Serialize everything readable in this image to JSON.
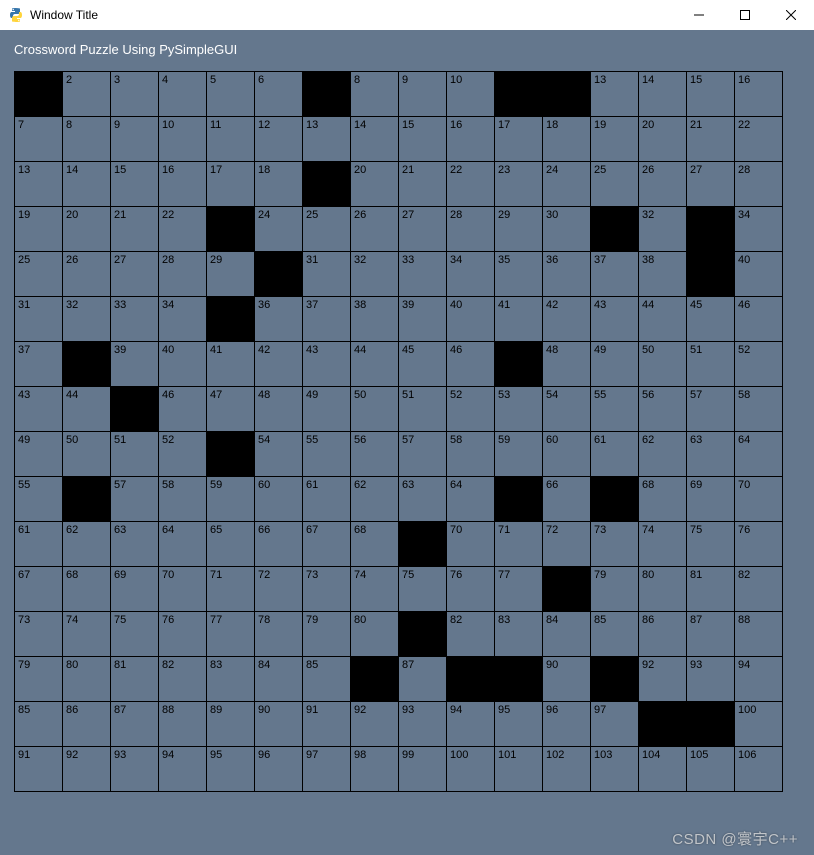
{
  "window": {
    "title": "Window Title"
  },
  "heading": "Crossword Puzzle Using PySimpleGUI",
  "watermark": "CSDN @寰宇C++",
  "grid": {
    "cols": 16,
    "rows": 16,
    "cells": [
      [
        {
          "b": true
        },
        {
          "n": "2"
        },
        {
          "n": "3"
        },
        {
          "n": "4"
        },
        {
          "n": "5"
        },
        {
          "n": "6"
        },
        {
          "b": true
        },
        {
          "n": "8"
        },
        {
          "n": "9"
        },
        {
          "n": "10"
        },
        {
          "b": true
        },
        {
          "b": true
        },
        {
          "n": "13"
        },
        {
          "n": "14"
        },
        {
          "n": "15"
        },
        {
          "n": "16"
        }
      ],
      [
        {
          "n": "7"
        },
        {
          "n": "8"
        },
        {
          "n": "9"
        },
        {
          "n": "10"
        },
        {
          "n": "11"
        },
        {
          "n": "12"
        },
        {
          "n": "13"
        },
        {
          "n": "14"
        },
        {
          "n": "15"
        },
        {
          "n": "16"
        },
        {
          "n": "17"
        },
        {
          "n": "18"
        },
        {
          "n": "19"
        },
        {
          "n": "20"
        },
        {
          "n": "21"
        },
        {
          "n": "22"
        }
      ],
      [
        {
          "n": "13"
        },
        {
          "n": "14"
        },
        {
          "n": "15"
        },
        {
          "n": "16"
        },
        {
          "n": "17"
        },
        {
          "n": "18"
        },
        {
          "b": true
        },
        {
          "n": "20"
        },
        {
          "n": "21"
        },
        {
          "n": "22"
        },
        {
          "n": "23"
        },
        {
          "n": "24"
        },
        {
          "n": "25"
        },
        {
          "n": "26"
        },
        {
          "n": "27"
        },
        {
          "n": "28"
        }
      ],
      [
        {
          "n": "19"
        },
        {
          "n": "20"
        },
        {
          "n": "21"
        },
        {
          "n": "22"
        },
        {
          "b": true
        },
        {
          "n": "24"
        },
        {
          "n": "25"
        },
        {
          "n": "26"
        },
        {
          "n": "27"
        },
        {
          "n": "28"
        },
        {
          "n": "29"
        },
        {
          "n": "30"
        },
        {
          "b": true
        },
        {
          "n": "32"
        },
        {
          "b": true
        },
        {
          "n": "34"
        }
      ],
      [
        {
          "n": "25"
        },
        {
          "n": "26"
        },
        {
          "n": "27"
        },
        {
          "n": "28"
        },
        {
          "n": "29"
        },
        {
          "b": true
        },
        {
          "n": "31"
        },
        {
          "n": "32"
        },
        {
          "n": "33"
        },
        {
          "n": "34"
        },
        {
          "n": "35"
        },
        {
          "n": "36"
        },
        {
          "n": "37"
        },
        {
          "n": "38"
        },
        {
          "b": true
        },
        {
          "n": "40"
        }
      ],
      [
        {
          "n": "31"
        },
        {
          "n": "32"
        },
        {
          "n": "33"
        },
        {
          "n": "34"
        },
        {
          "b": true
        },
        {
          "n": "36"
        },
        {
          "n": "37"
        },
        {
          "n": "38"
        },
        {
          "n": "39"
        },
        {
          "n": "40"
        },
        {
          "n": "41"
        },
        {
          "n": "42"
        },
        {
          "n": "43"
        },
        {
          "n": "44"
        },
        {
          "n": "45"
        },
        {
          "n": "46"
        }
      ],
      [
        {
          "n": "37"
        },
        {
          "b": true
        },
        {
          "n": "39"
        },
        {
          "n": "40"
        },
        {
          "n": "41"
        },
        {
          "n": "42"
        },
        {
          "n": "43"
        },
        {
          "n": "44"
        },
        {
          "n": "45"
        },
        {
          "n": "46"
        },
        {
          "b": true
        },
        {
          "n": "48"
        },
        {
          "n": "49"
        },
        {
          "n": "50"
        },
        {
          "n": "51"
        },
        {
          "n": "52"
        }
      ],
      [
        {
          "n": "43"
        },
        {
          "n": "44"
        },
        {
          "b": true
        },
        {
          "n": "46"
        },
        {
          "n": "47"
        },
        {
          "n": "48"
        },
        {
          "n": "49"
        },
        {
          "n": "50"
        },
        {
          "n": "51"
        },
        {
          "n": "52"
        },
        {
          "n": "53"
        },
        {
          "n": "54"
        },
        {
          "n": "55"
        },
        {
          "n": "56"
        },
        {
          "n": "57"
        },
        {
          "n": "58"
        }
      ],
      [
        {
          "n": "49"
        },
        {
          "n": "50"
        },
        {
          "n": "51"
        },
        {
          "n": "52"
        },
        {
          "b": true
        },
        {
          "n": "54"
        },
        {
          "n": "55"
        },
        {
          "n": "56"
        },
        {
          "n": "57"
        },
        {
          "n": "58"
        },
        {
          "n": "59"
        },
        {
          "n": "60"
        },
        {
          "n": "61"
        },
        {
          "n": "62"
        },
        {
          "n": "63"
        },
        {
          "n": "64"
        }
      ],
      [
        {
          "n": "55"
        },
        {
          "b": true
        },
        {
          "n": "57"
        },
        {
          "n": "58"
        },
        {
          "n": "59"
        },
        {
          "n": "60"
        },
        {
          "n": "61"
        },
        {
          "n": "62"
        },
        {
          "n": "63"
        },
        {
          "n": "64"
        },
        {
          "b": true
        },
        {
          "n": "66"
        },
        {
          "b": true
        },
        {
          "n": "68"
        },
        {
          "n": "69"
        },
        {
          "n": "70"
        }
      ],
      [
        {
          "n": "61"
        },
        {
          "n": "62"
        },
        {
          "n": "63"
        },
        {
          "n": "64"
        },
        {
          "n": "65"
        },
        {
          "n": "66"
        },
        {
          "n": "67"
        },
        {
          "n": "68"
        },
        {
          "b": true
        },
        {
          "n": "70"
        },
        {
          "n": "71"
        },
        {
          "n": "72"
        },
        {
          "n": "73"
        },
        {
          "n": "74"
        },
        {
          "n": "75"
        },
        {
          "n": "76"
        }
      ],
      [
        {
          "n": "67"
        },
        {
          "n": "68"
        },
        {
          "n": "69"
        },
        {
          "n": "70"
        },
        {
          "n": "71"
        },
        {
          "n": "72"
        },
        {
          "n": "73"
        },
        {
          "n": "74"
        },
        {
          "n": "75"
        },
        {
          "n": "76"
        },
        {
          "n": "77"
        },
        {
          "b": true
        },
        {
          "n": "79"
        },
        {
          "n": "80"
        },
        {
          "n": "81"
        },
        {
          "n": "82"
        }
      ],
      [
        {
          "n": "73"
        },
        {
          "n": "74"
        },
        {
          "n": "75"
        },
        {
          "n": "76"
        },
        {
          "n": "77"
        },
        {
          "n": "78"
        },
        {
          "n": "79"
        },
        {
          "n": "80"
        },
        {
          "b": true
        },
        {
          "n": "82"
        },
        {
          "n": "83"
        },
        {
          "n": "84"
        },
        {
          "n": "85"
        },
        {
          "n": "86"
        },
        {
          "n": "87"
        },
        {
          "n": "88"
        }
      ],
      [
        {
          "n": "79"
        },
        {
          "n": "80"
        },
        {
          "n": "81"
        },
        {
          "n": "82"
        },
        {
          "n": "83"
        },
        {
          "n": "84"
        },
        {
          "n": "85"
        },
        {
          "b": true
        },
        {
          "n": "87"
        },
        {
          "b": true
        },
        {
          "b": true
        },
        {
          "n": "90"
        },
        {
          "b": true
        },
        {
          "n": "92"
        },
        {
          "n": "93"
        },
        {
          "n": "94"
        }
      ],
      [
        {
          "n": "85"
        },
        {
          "n": "86"
        },
        {
          "n": "87"
        },
        {
          "n": "88"
        },
        {
          "n": "89"
        },
        {
          "n": "90"
        },
        {
          "n": "91"
        },
        {
          "n": "92"
        },
        {
          "n": "93"
        },
        {
          "n": "94"
        },
        {
          "n": "95"
        },
        {
          "n": "96"
        },
        {
          "n": "97"
        },
        {
          "b": true
        },
        {
          "b": true
        },
        {
          "n": "100"
        }
      ],
      [
        {
          "n": "91"
        },
        {
          "n": "92"
        },
        {
          "n": "93"
        },
        {
          "n": "94"
        },
        {
          "n": "95"
        },
        {
          "n": "96"
        },
        {
          "n": "97"
        },
        {
          "n": "98"
        },
        {
          "n": "99"
        },
        {
          "n": "100"
        },
        {
          "n": "101"
        },
        {
          "n": "102"
        },
        {
          "n": "103"
        },
        {
          "n": "104"
        },
        {
          "n": "105"
        },
        {
          "n": "106"
        }
      ]
    ]
  }
}
